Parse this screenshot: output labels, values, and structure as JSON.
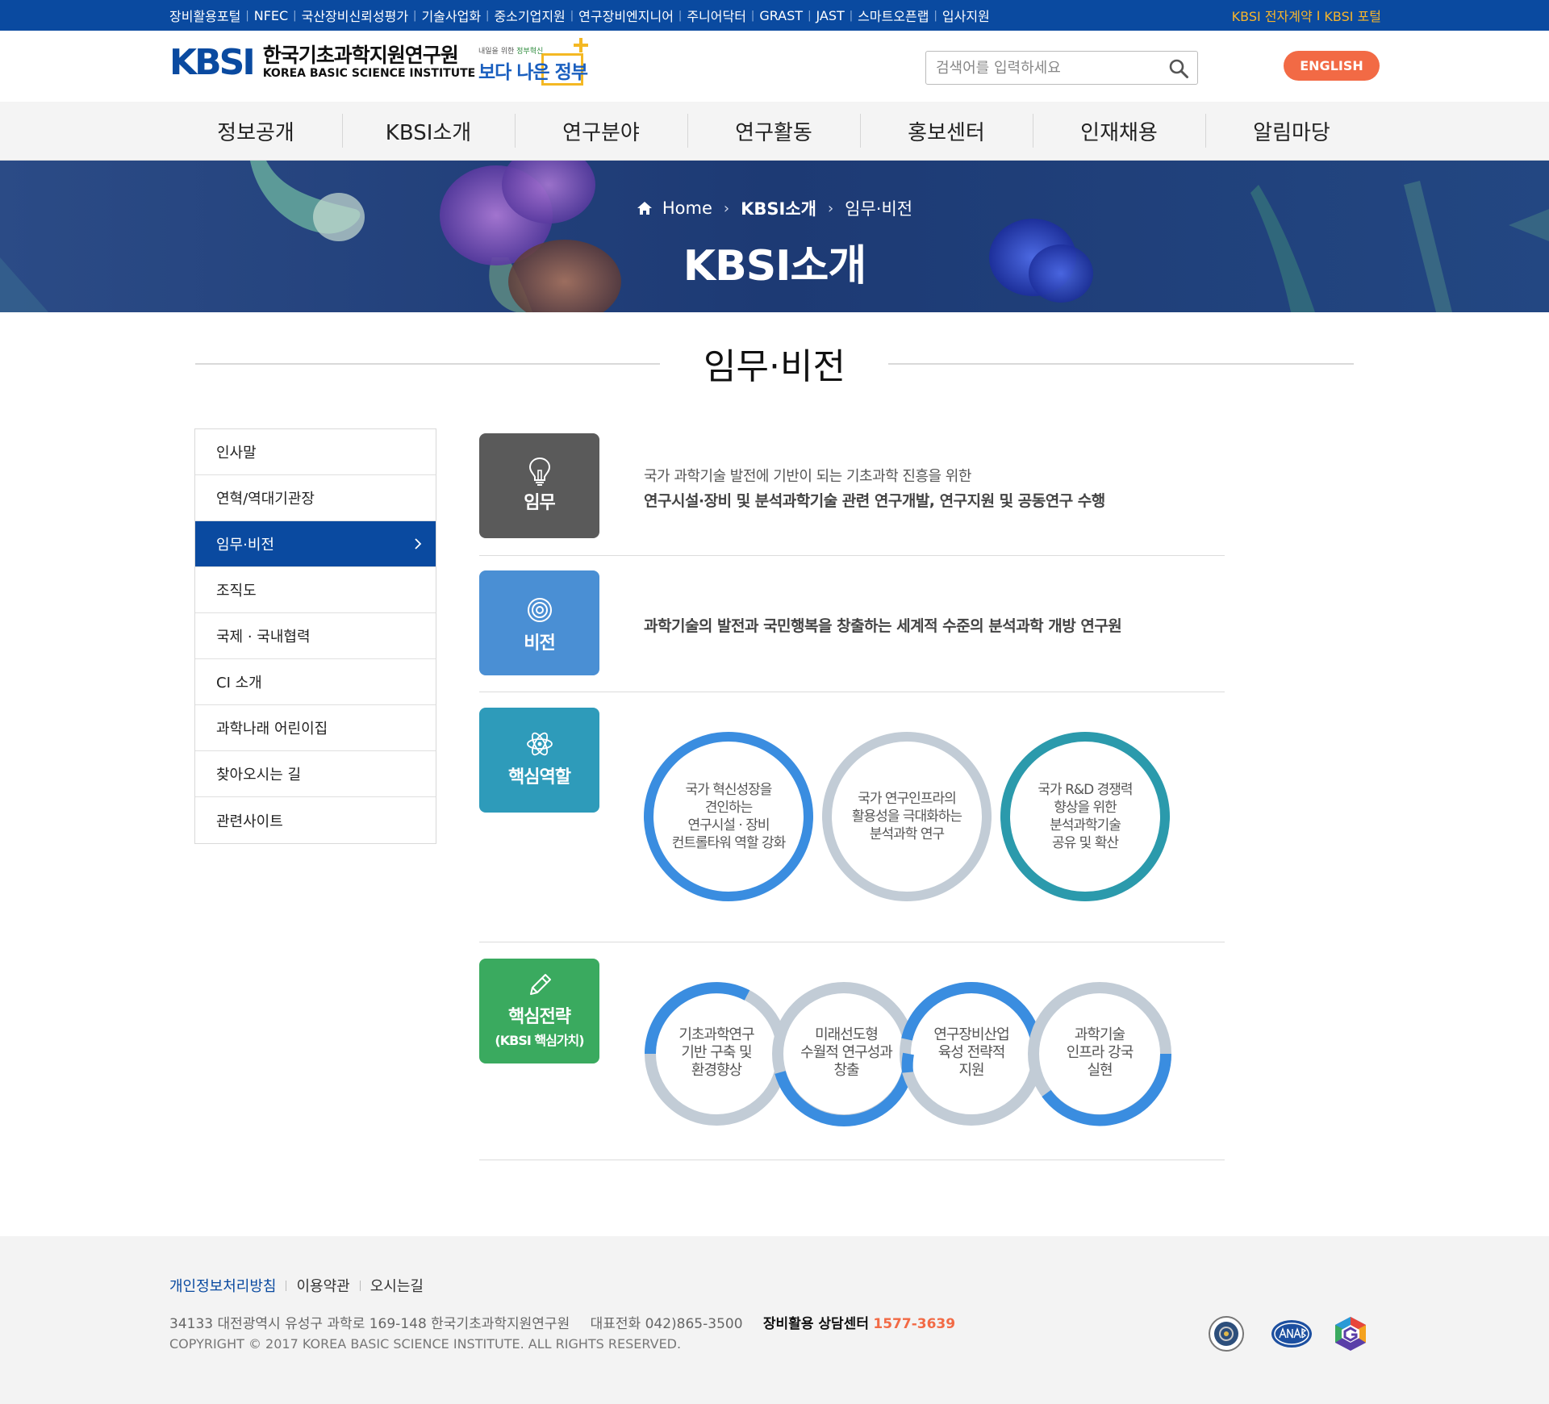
{
  "topbar": {
    "links": [
      "장비활용포털",
      "NFEC",
      "국산장비신뢰성평가",
      "기술사업화",
      "중소기업지원",
      "연구장비엔지니어",
      "주니어닥터",
      "GRAST",
      "JAST",
      "스마트오픈랩",
      "입사지원"
    ],
    "right_links": [
      "KBSI 전자계약",
      "KBSI 포털"
    ],
    "right_sep": "I"
  },
  "header": {
    "logo_mark": "KBSI",
    "logo_ko": "한국기초과학지원연구원",
    "logo_en": "KOREA BASIC SCIENCE INSTITUTE",
    "gov_small_1": "내일을 위한",
    "gov_small_2": "정부혁신",
    "gov_big": "보다 나은 정부",
    "search_placeholder": "검색어를 입력하세요",
    "english_label": "ENGLISH"
  },
  "gnb": [
    "정보공개",
    "KBSI소개",
    "연구분야",
    "연구활동",
    "홍보센터",
    "인재채용",
    "알림마당"
  ],
  "banner": {
    "home": "Home",
    "crumb_1": "KBSI소개",
    "crumb_2": "임무·비전",
    "title": "KBSI소개"
  },
  "page_title": "임무·비전",
  "lnb": [
    "인사말",
    "연혁/역대기관장",
    "임무·비전",
    "조직도",
    "국제 · 국내협력",
    "CI 소개",
    "과학나래 어린이집",
    "찾아오시는 길",
    "관련사이트"
  ],
  "lnb_active_index": 2,
  "mission": {
    "label": "임무",
    "line1": "국가 과학기술 발전에 기반이 되는 기초과학 진흥을 위한",
    "line2": "연구시설·장비 및 분석과학기술 관련 연구개발, 연구지원 및 공동연구 수행"
  },
  "vision": {
    "label": "비전",
    "text": "과학기술의 발전과 국민행복을 창출하는 세계적 수준의 분석과학 개방 연구원"
  },
  "core_roles": {
    "label": "핵심역할",
    "circles": [
      {
        "lines": [
          "국가 혁신성장을",
          "견인하는",
          "연구시설 · 장비",
          "컨트롤타워 역할 강화"
        ],
        "color": "#3a8de0"
      },
      {
        "lines": [
          "국가 연구인프라의",
          "활용성을 극대화하는",
          "분석과학 연구"
        ],
        "color": "#c2ccd6"
      },
      {
        "lines": [
          "국가 R&D 경쟁력",
          "향상을 위한",
          "분석과학기술",
          "공유 및 확산"
        ],
        "color": "#2b9aac"
      }
    ]
  },
  "core_strategy": {
    "label": "핵심전략",
    "label2": "(KBSI 핵심가치)",
    "rings": [
      {
        "lines": [
          "기초과학연구",
          "기반 구축 및",
          "환경향상"
        ]
      },
      {
        "lines": [
          "미래선도형",
          "수월적 연구성과",
          "창출"
        ]
      },
      {
        "lines": [
          "연구장비산업",
          "육성 전략적",
          "지원"
        ]
      },
      {
        "lines": [
          "과학기술",
          "인프라 강국",
          "실현"
        ]
      }
    ]
  },
  "colors": {
    "brand_blue": "#0a4aa0",
    "mission_box": "#5a5a5a",
    "vision_box": "#4a8fd4",
    "roles_box": "#2e9bba",
    "strategy_box": "#3aaa5f",
    "accent_orange": "#f26a45",
    "topbar_yellow": "#f7b52b"
  },
  "footer": {
    "links": [
      "개인정보처리방침",
      "이용약관",
      "오시는길"
    ],
    "address": "34133 대전광역시 유성구 과학로 169-148 한국기초과학지원연구원",
    "tel": "대표전화 042)865-3500",
    "center_label": "장비활용 상담센터",
    "center_phone": "1577-3639",
    "copyright": "COPYRIGHT © 2017 KOREA BASIC SCIENCE INSTITUTE. ALL RIGHTS RESERVED.",
    "cert_icons": [
      "iso-seal-icon",
      "anab-logo-icon",
      "g-logo-icon"
    ]
  }
}
